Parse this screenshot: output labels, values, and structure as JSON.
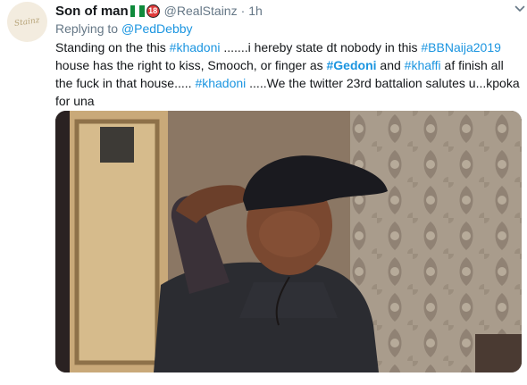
{
  "tweet": {
    "display_name": "Son of man",
    "badge": "18",
    "handle": "@RealStainz",
    "separator": "·",
    "time": "1h",
    "replying_prefix": "Replying to",
    "replying_to": "@PedDebby",
    "body": {
      "t1": "Standing on the this ",
      "h1": "#khadoni",
      "t2": " .......i hereby state dt nobody in this ",
      "h2": "#BBNaija2019",
      "t3": " house has the right to kiss, Smooch, or finger as ",
      "h3": "#Gedoni",
      "t4": " and ",
      "h4": "#khaffi",
      "t5": " af finish all the fuck in that house..... ",
      "h5": "#khadoni",
      "t6": " .....We the twitter 23rd battalion salutes u...kpoka for una"
    },
    "avatar_text": "Stainz"
  },
  "colors": {
    "link": "#1b95e0",
    "muted": "#657786",
    "text": "#14171a"
  },
  "icons": [
    "nigeria-flag-icon",
    "age-18-badge-icon",
    "chevron-down-icon"
  ]
}
